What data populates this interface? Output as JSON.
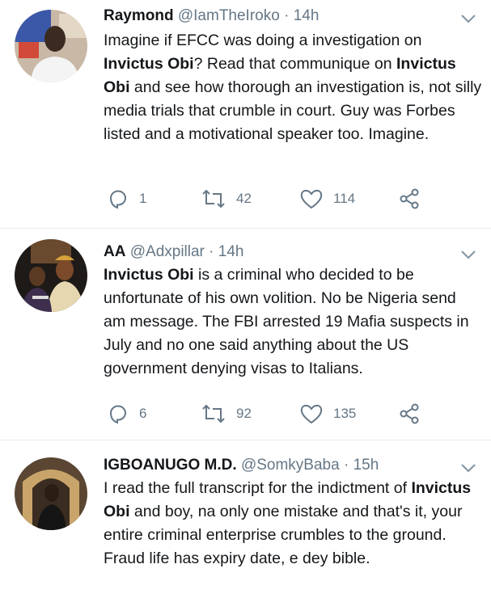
{
  "tweets": [
    {
      "name": "Raymond",
      "handle": "@IamTheIroko",
      "time": "· 14h",
      "text_parts": [
        {
          "t": "Imagine if EFCC was doing a investigation on ",
          "b": false
        },
        {
          "t": "Invictus Obi",
          "b": true
        },
        {
          "t": "? Read that communique on ",
          "b": false
        },
        {
          "t": "Invictus Obi",
          "b": true
        },
        {
          "t": " and see how thorough an investigation is, not silly media trials that crumble in court. Guy was Forbes listed and a motivational speaker too. Imagine.",
          "b": false
        }
      ],
      "replies": "1",
      "retweets": "42",
      "likes": "114"
    },
    {
      "name": "AA",
      "handle": "@Adxpillar",
      "time": "· 14h",
      "text_parts": [
        {
          "t": "Invictus Obi",
          "b": true
        },
        {
          "t": " is a criminal who decided to be unfortunate of his own volition. No be Nigeria send am message. The FBI arrested 19 Mafia suspects in July and no one said anything about the US government denying visas to Italians.",
          "b": false
        }
      ],
      "replies": "6",
      "retweets": "92",
      "likes": "135"
    },
    {
      "name": "IGBOANUGO M.D.",
      "handle": "@SomkyBaba",
      "time": "· 15h",
      "text_parts": [
        {
          "t": "I read the full transcript for the indictment of ",
          "b": false
        },
        {
          "t": "Invictus Obi",
          "b": true
        },
        {
          "t": " and boy, na only one mistake and that's it, your entire criminal enterprise crumbles to the ground. Fraud life has expiry date, e dey bible.",
          "b": false
        }
      ]
    }
  ],
  "colors": {
    "text": "#14171a",
    "muted": "#657786",
    "divider": "#e6ecf0"
  },
  "icons": [
    "reply-icon",
    "retweet-icon",
    "like-icon",
    "share-icon",
    "chevron-down-icon"
  ]
}
